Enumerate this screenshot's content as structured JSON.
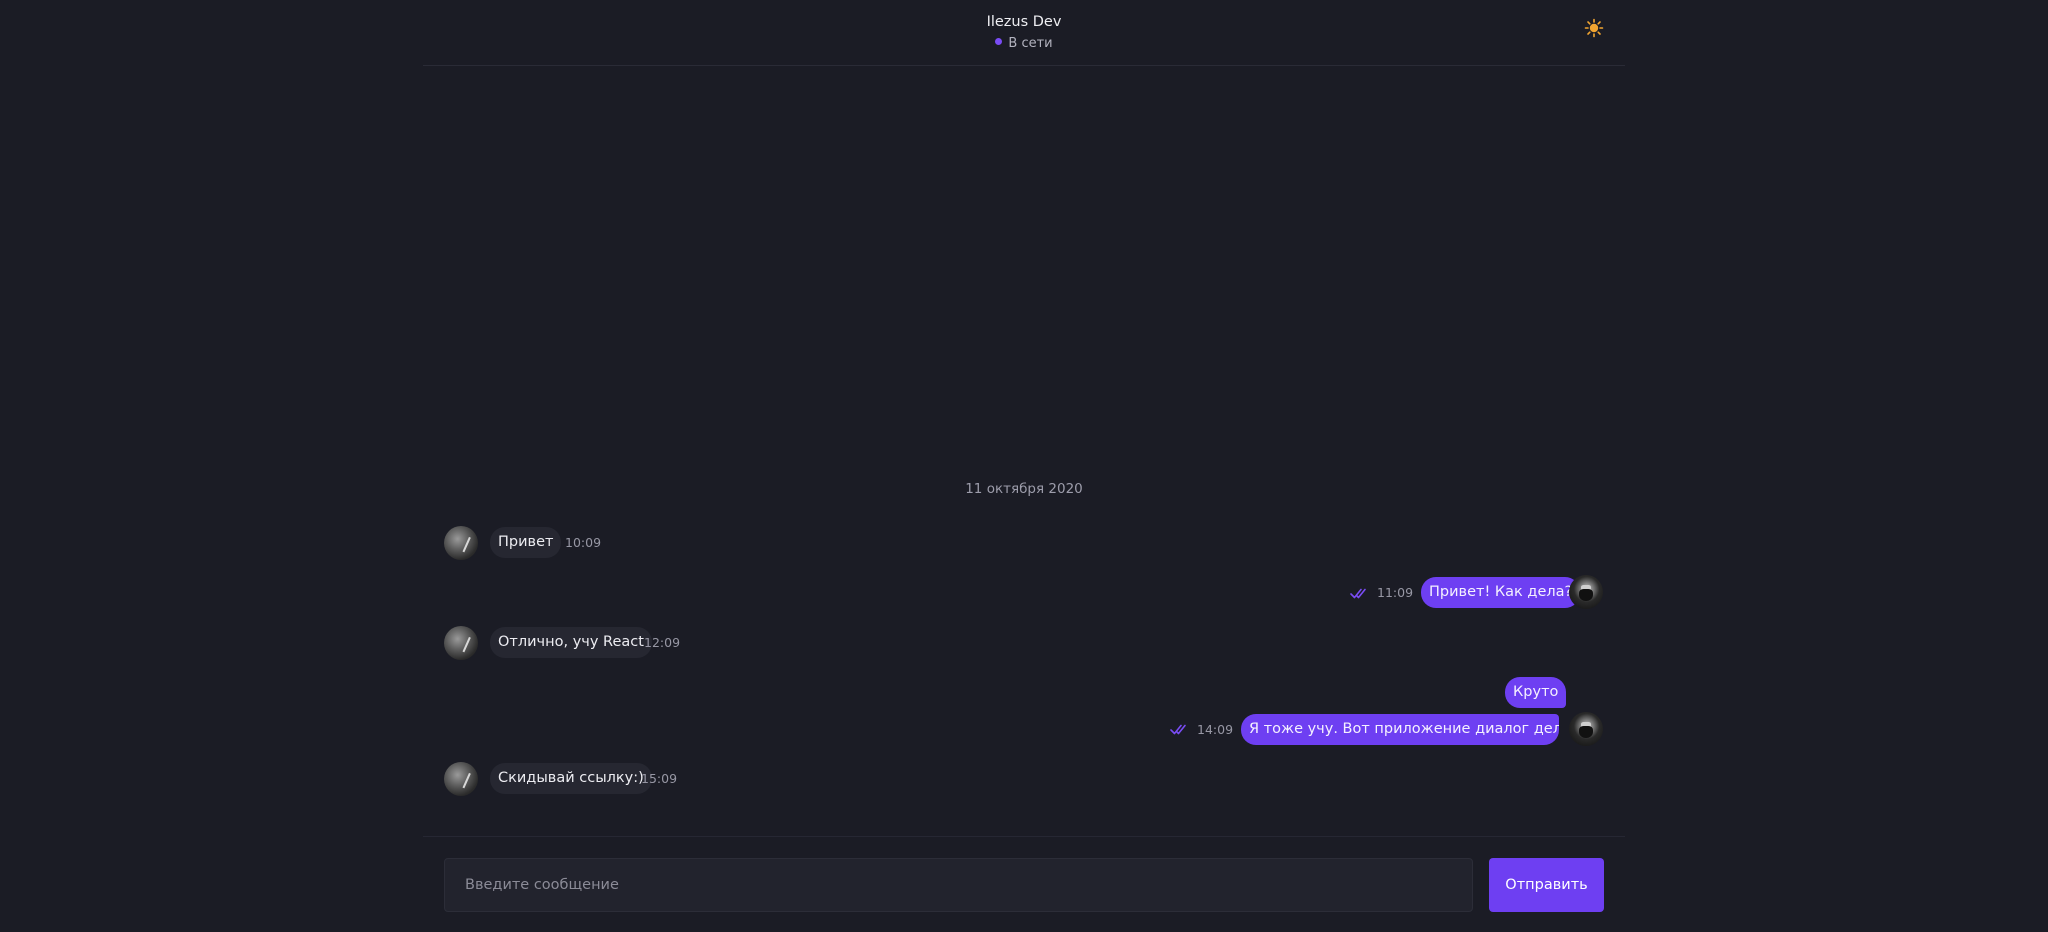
{
  "header": {
    "title": "Ilezus Dev",
    "status": "В сети",
    "theme_icon": "sun-icon"
  },
  "chat": {
    "date_divider": "11 октября 2020",
    "messages": [
      {
        "direction": "incoming",
        "text": "Привет",
        "time": "10:09"
      },
      {
        "direction": "outgoing",
        "text": "Привет! Как дела?",
        "time": "11:09",
        "read": true
      },
      {
        "direction": "incoming",
        "text": "Отлично, учу React",
        "time": "12:09"
      },
      {
        "direction": "outgoing",
        "text": "Круто",
        "time": "",
        "read": true
      },
      {
        "direction": "outgoing",
        "text": "Я тоже учу. Вот приложение диалог делаю...",
        "time": "14:09",
        "read": true
      },
      {
        "direction": "incoming",
        "text": "Скидывай ссылку:)",
        "time": "15:09"
      }
    ]
  },
  "composer": {
    "placeholder": "Введите сообщение",
    "value": "",
    "send_label": "Отправить"
  },
  "colors": {
    "background": "#1b1c25",
    "accent": "#6e3ff2",
    "incoming_bubble": "#262731",
    "theme_icon": "#f2a531"
  }
}
